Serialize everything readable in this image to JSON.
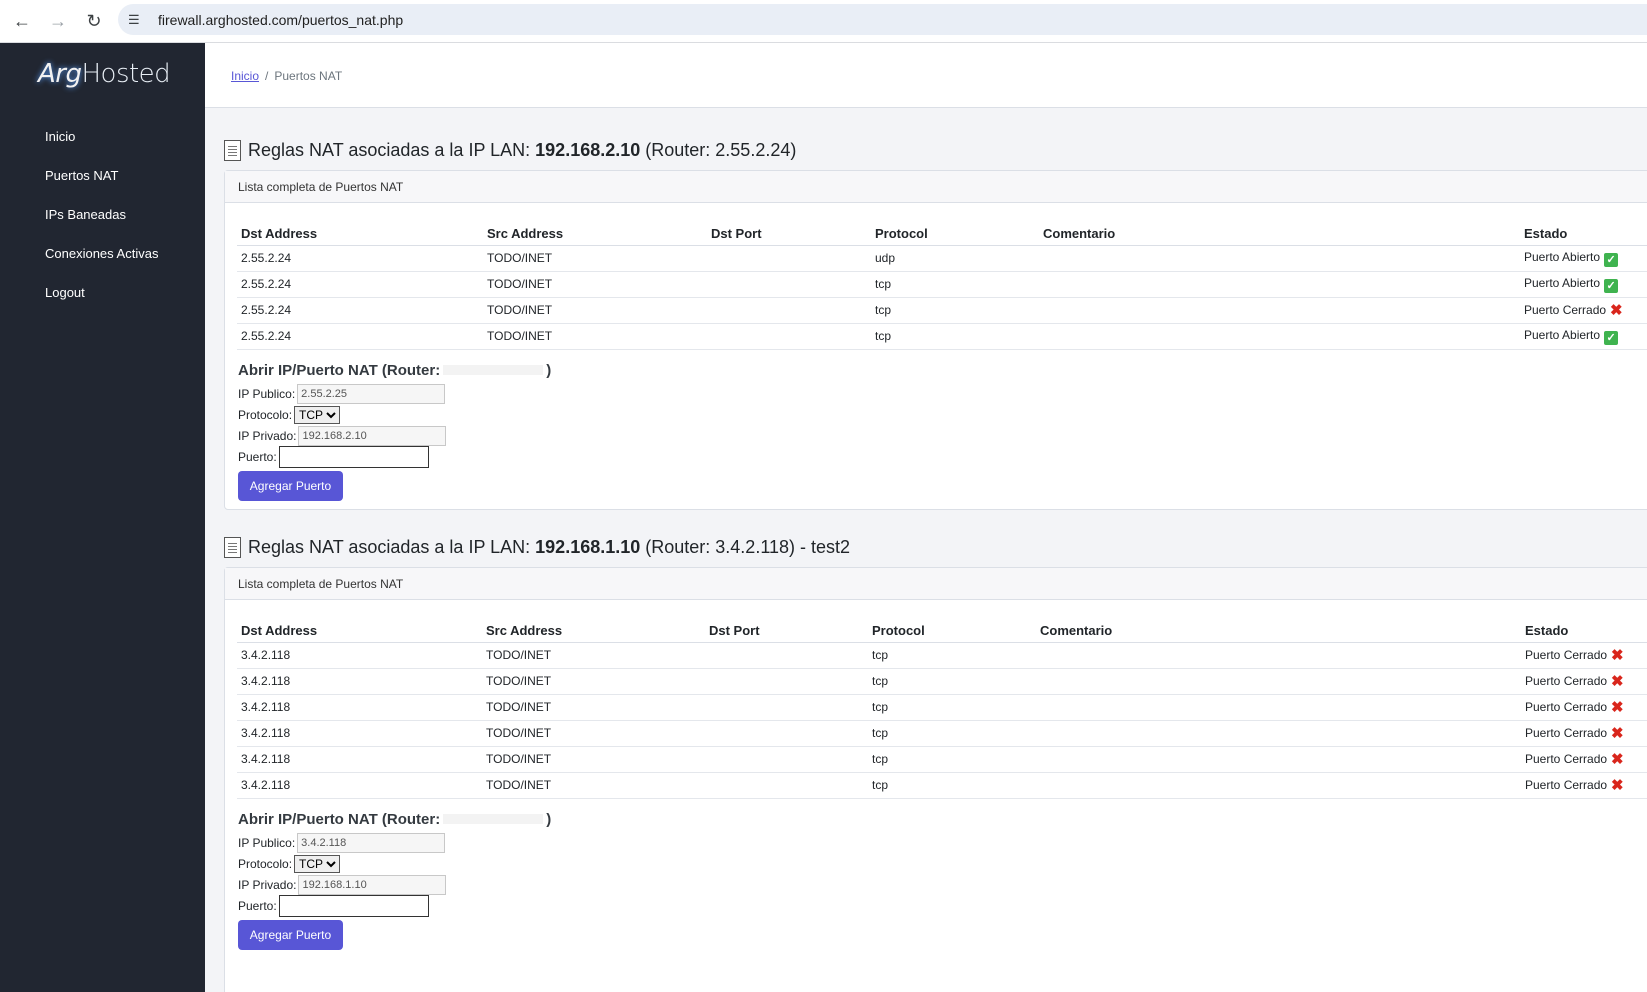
{
  "browser": {
    "url": "firewall.arghosted.com/puertos_nat.php"
  },
  "logo": {
    "part1": "Arg",
    "part2": "Hosted"
  },
  "sidebar": {
    "items": [
      {
        "label": "Inicio"
      },
      {
        "label": "Puertos NAT"
      },
      {
        "label": "IPs Baneadas"
      },
      {
        "label": "Conexiones Activas"
      },
      {
        "label": "Logout"
      }
    ]
  },
  "breadcrumb": {
    "home": "Inicio",
    "separator": "/",
    "current": "Puertos NAT"
  },
  "table_headers": {
    "dst_address": "Dst Address",
    "src_address": "Src Address",
    "dst_port": "Dst Port",
    "protocol": "Protocol",
    "comentario": "Comentario",
    "estado": "Estado"
  },
  "sections": [
    {
      "title_prefix": "Reglas NAT asociadas a la IP LAN:",
      "lan_ip": "192.168.2.10",
      "title_suffix": "(Router: 2.55.2.24)",
      "card_header": "Lista completa de Puertos NAT",
      "rows": [
        {
          "dst": "2.55.2.24",
          "src": "TODO/INET",
          "port": "",
          "proto": "udp",
          "comment": "",
          "state": "Puerto Abierto",
          "status": "open"
        },
        {
          "dst": "2.55.2.24",
          "src": "TODO/INET",
          "port": "",
          "proto": "tcp",
          "comment": "",
          "state": "Puerto Abierto",
          "status": "open"
        },
        {
          "dst": "2.55.2.24",
          "src": "TODO/INET",
          "port": "",
          "proto": "tcp",
          "comment": "",
          "state": "Puerto Cerrado",
          "status": "closed"
        },
        {
          "dst": "2.55.2.24",
          "src": "TODO/INET",
          "port": "",
          "proto": "tcp",
          "comment": "",
          "state": "Puerto Abierto",
          "status": "open"
        }
      ],
      "form": {
        "title_prefix": "Abrir IP/Puerto NAT (Router:",
        "title_suffix": ")",
        "ip_publico_label": "IP Publico:",
        "ip_publico_value": "2.55.2.25",
        "protocolo_label": "Protocolo:",
        "protocolo_value": "TCP",
        "ip_privado_label": "IP Privado:",
        "ip_privado_value": "192.168.2.10",
        "puerto_label": "Puerto:",
        "puerto_value": "",
        "button": "Agregar Puerto"
      }
    },
    {
      "title_prefix": "Reglas NAT asociadas a la IP LAN:",
      "lan_ip": "192.168.1.10",
      "title_suffix": "(Router: 3.4.2.118) - test2",
      "card_header": "Lista completa de Puertos NAT",
      "rows": [
        {
          "dst": "3.4.2.118",
          "src": "TODO/INET",
          "port": "",
          "proto": "tcp",
          "comment": "",
          "state": "Puerto Cerrado",
          "status": "closed"
        },
        {
          "dst": "3.4.2.118",
          "src": "TODO/INET",
          "port": "",
          "proto": "tcp",
          "comment": "",
          "state": "Puerto Cerrado",
          "status": "closed"
        },
        {
          "dst": "3.4.2.118",
          "src": "TODO/INET",
          "port": "",
          "proto": "tcp",
          "comment": "",
          "state": "Puerto Cerrado",
          "status": "closed"
        },
        {
          "dst": "3.4.2.118",
          "src": "TODO/INET",
          "port": "",
          "proto": "tcp",
          "comment": "",
          "state": "Puerto Cerrado",
          "status": "closed"
        },
        {
          "dst": "3.4.2.118",
          "src": "TODO/INET",
          "port": "",
          "proto": "tcp",
          "comment": "",
          "state": "Puerto Cerrado",
          "status": "closed"
        },
        {
          "dst": "3.4.2.118",
          "src": "TODO/INET",
          "port": "",
          "proto": "tcp",
          "comment": "",
          "state": "Puerto Cerrado",
          "status": "closed"
        }
      ],
      "form": {
        "title_prefix": "Abrir IP/Puerto NAT (Router:",
        "title_suffix": ")",
        "ip_publico_label": "IP Publico:",
        "ip_publico_value": "3.4.2.118",
        "protocolo_label": "Protocolo:",
        "protocolo_value": "TCP",
        "ip_privado_label": "IP Privado:",
        "ip_privado_value": "192.168.1.10",
        "puerto_label": "Puerto:",
        "puerto_value": "",
        "button": "Agregar Puerto"
      }
    }
  ],
  "status_icons": {
    "open": "check-icon",
    "closed": "cross-icon"
  },
  "colors": {
    "sidebar_bg": "#212631",
    "accent": "#5856d6",
    "open": "#3fb34f",
    "closed": "#d9261c"
  }
}
